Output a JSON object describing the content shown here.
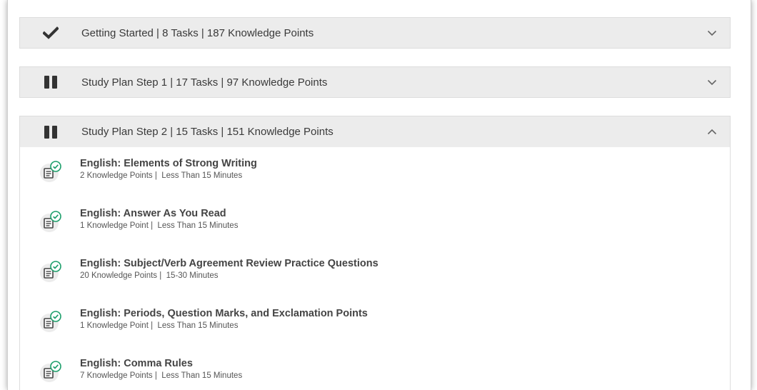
{
  "sections": [
    {
      "status_icon": "checkmark-icon",
      "label": "Getting Started | 8 Tasks | 187 Knowledge Points",
      "expanded": false
    },
    {
      "status_icon": "pause-icon",
      "label": "Study Plan Step 1 | 17 Tasks | 97 Knowledge Points",
      "expanded": false
    },
    {
      "status_icon": "pause-icon",
      "label": "Study Plan Step 2 | 15 Tasks | 151 Knowledge Points",
      "expanded": true
    }
  ],
  "tasks": [
    {
      "title": "English: Elements of Strong Writing",
      "points": "2 Knowledge Points",
      "separator": "|",
      "duration": "Less Than 15 Minutes",
      "icon": "completed-lesson-icon"
    },
    {
      "title": "English: Answer As You Read",
      "points": "1 Knowledge Point",
      "separator": "|",
      "duration": "Less Than 15 Minutes",
      "icon": "completed-lesson-icon"
    },
    {
      "title": "English: Subject/Verb Agreement Review Practice Questions",
      "points": "20 Knowledge Points",
      "separator": "|",
      "duration": "15-30 Minutes",
      "icon": "completed-lesson-icon"
    },
    {
      "title": "English: Periods, Question Marks, and Exclamation Points",
      "points": "1 Knowledge Point",
      "separator": "|",
      "duration": "Less Than 15 Minutes",
      "icon": "completed-lesson-icon"
    },
    {
      "title": "English: Comma Rules",
      "points": "7 Knowledge Points",
      "separator": "|",
      "duration": "Less Than 15 Minutes",
      "icon": "completed-lesson-icon"
    }
  ],
  "colors": {
    "header_bg": "#ececec",
    "icon_dark": "#333333",
    "check_green": "#1b9e6a"
  }
}
